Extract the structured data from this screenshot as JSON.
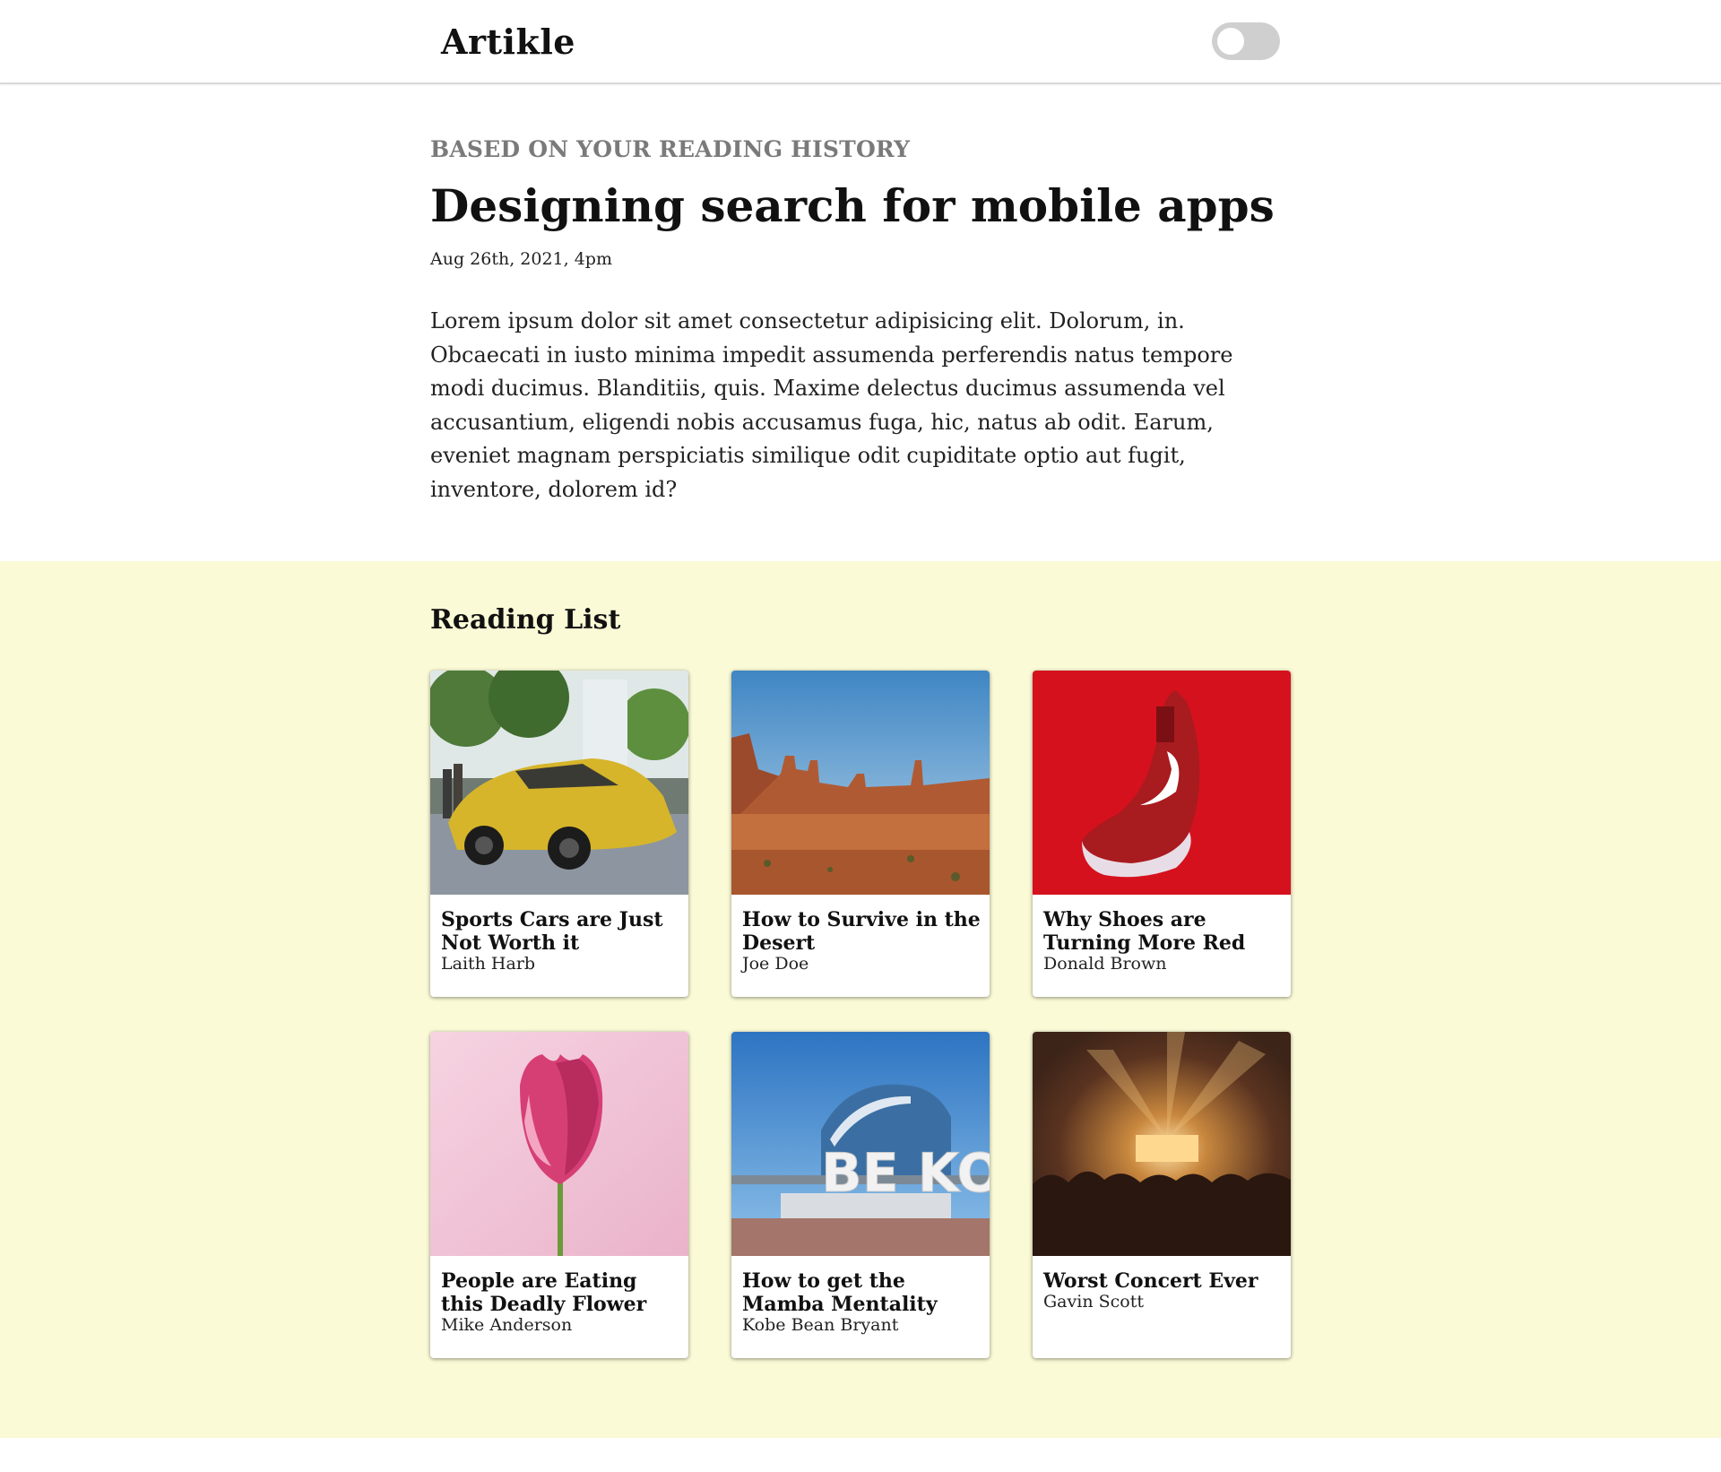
{
  "header": {
    "logo": "Artikle",
    "theme_toggle": "off"
  },
  "featured": {
    "eyebrow": "BASED ON YOUR READING HISTORY",
    "title": "Designing search for mobile apps",
    "date": "Aug 26th, 2021, 4pm",
    "excerpt": "Lorem ipsum dolor sit amet consectetur adipisicing elit. Dolorum, in. Obcaecati in iusto minima impedit assumenda perferendis natus tempore modi ducimus. Blanditiis, quis. Maxime delectus ducimus assumenda vel accusantium, eligendi nobis accusamus fuga, hic, natus ab odit. Earum, eveniet magnam perspiciatis similique odit cupiditate optio aut fugit, inventore, dolorem id?"
  },
  "reading_list": {
    "title": "Reading List",
    "items": [
      {
        "title": "Sports Cars are Just Not Worth it",
        "author": "Laith Harb",
        "image": "yellow-sports-car"
      },
      {
        "title": "How to Survive in the Desert",
        "author": "Joe Doe",
        "image": "desert-canyon"
      },
      {
        "title": "Why Shoes are Turning More Red",
        "author": "Donald Brown",
        "image": "red-sneaker"
      },
      {
        "title": "People are Eating this Deadly Flower",
        "author": "Mike Anderson",
        "image": "pink-tulip"
      },
      {
        "title": "How to get the Mamba Mentality",
        "author": "Kobe Bean Bryant",
        "image": "be-kobe-sign"
      },
      {
        "title": "Worst Concert Ever",
        "author": "Gavin Scott",
        "image": "concert-crowd"
      }
    ]
  }
}
